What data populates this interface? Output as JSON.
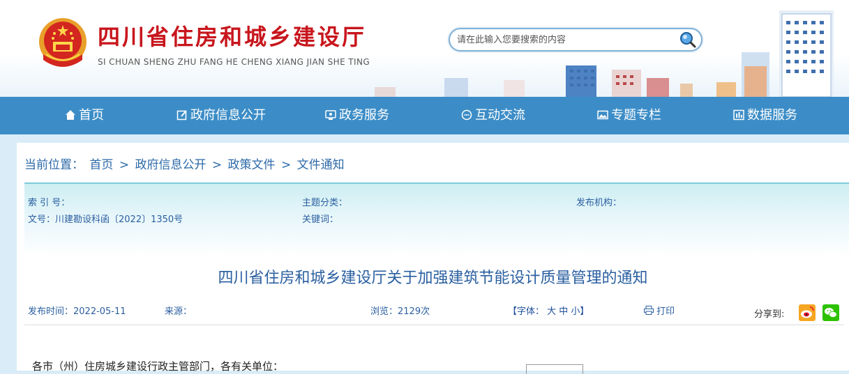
{
  "header": {
    "site_title": "四川省住房和城乡建设厅",
    "site_pinyin": "SI CHUAN SHENG ZHU FANG HE CHENG XIANG JIAN SHE TING",
    "search_placeholder": "请在此输入您要搜索的内容"
  },
  "nav": {
    "items": [
      {
        "label": "首页",
        "icon": "home-icon"
      },
      {
        "label": "政府信息公开",
        "icon": "edit-icon"
      },
      {
        "label": "政务服务",
        "icon": "monitor-icon"
      },
      {
        "label": "互动交流",
        "icon": "chat-icon"
      },
      {
        "label": "专题专栏",
        "icon": "image-icon"
      },
      {
        "label": "数据服务",
        "icon": "chart-icon"
      }
    ]
  },
  "breadcrumb": {
    "prefix": "当前位置：",
    "items": [
      "首页",
      "政府信息公开",
      "政策文件",
      "文件通知"
    ],
    "separator": ">"
  },
  "meta": {
    "index_label": "索 引 号：",
    "topic_label": "主题分类：",
    "publisher_label": "发布机构：",
    "doc_no": "文号：川建勘设科函〔2022〕1350号",
    "keywords_label": "关键词："
  },
  "article": {
    "title": "四川省住房和城乡建设厅关于加强建筑节能设计质量管理的通知",
    "publish_time": "发布时间：2022-05-11",
    "source_label": "来源：",
    "views": "浏览：2129次",
    "font_size_label": "【字体： 大 中 小】",
    "print_label": "打印",
    "share_label": "分享到:",
    "salutation": "各市（州）住房城乡建设行政主管部门，各有关单位："
  },
  "colors": {
    "nav_bg": "#3c8dc7",
    "title_red": "#c8161d",
    "link_blue": "#2a5fa0"
  }
}
